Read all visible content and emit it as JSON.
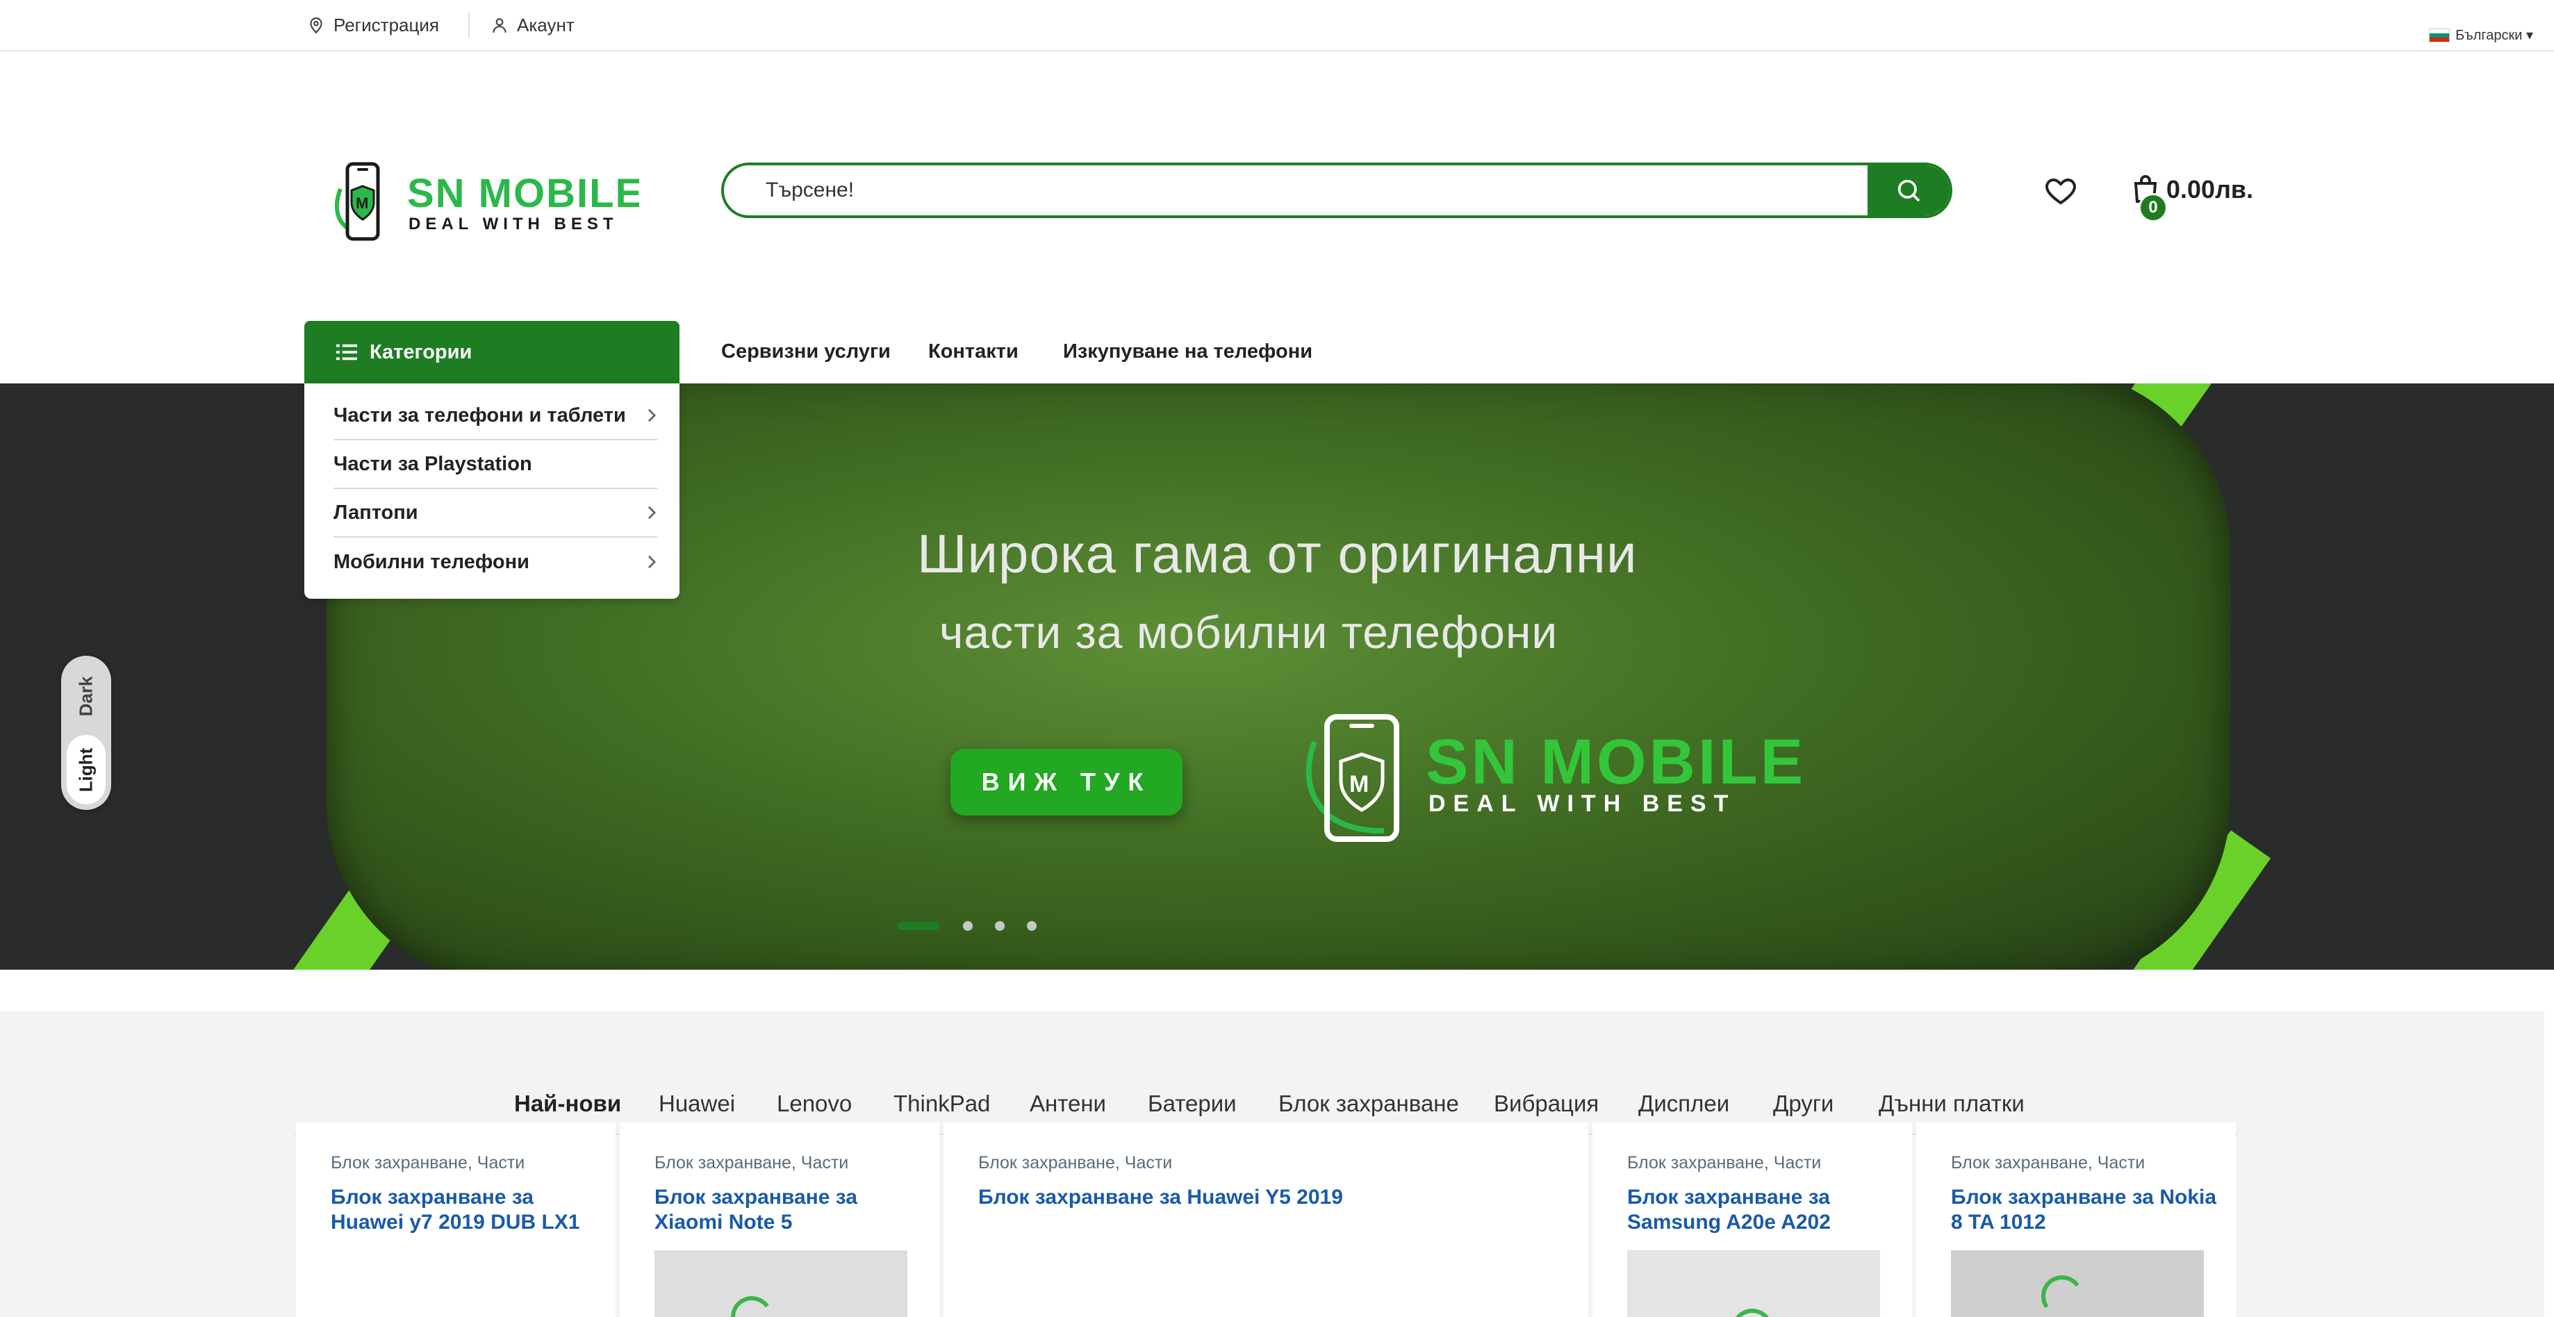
{
  "topbar": {
    "register_label": "Регистрация",
    "account_label": "Акаунт",
    "language_label": "Български ▾"
  },
  "header": {
    "search_placeholder": "Търсене!",
    "cart_count": "0",
    "cart_total": "0.00лв."
  },
  "nav": {
    "categories_label": "Категории",
    "links": [
      "Сервизни услуги",
      "Контакти",
      "Изкупуване на телефони"
    ]
  },
  "categories_menu": {
    "items": [
      {
        "label": "Части за телефони и таблети",
        "has_submenu": true
      },
      {
        "label": "Части за Playstation",
        "has_submenu": false
      },
      {
        "label": "Лаптопи",
        "has_submenu": true
      },
      {
        "label": "Мобилни телефони",
        "has_submenu": true
      }
    ]
  },
  "hero": {
    "line1": "Широка гама от оригинални",
    "line2": "части за мобилни телефони",
    "button_label": "ВИЖ ТУК",
    "slides_count": 4,
    "active_slide": 1
  },
  "theme_switcher": {
    "dark_label": "Dark",
    "light_label": "Light",
    "selected": "Light"
  },
  "products": {
    "tabs": [
      "Най-нови",
      "Huawei",
      "Lenovo",
      "ThinkPad",
      "Антени",
      "Батерии",
      "Блок захранване",
      "Вибрация",
      "Дисплеи",
      "Други",
      "Дънни платки"
    ],
    "active_tab": "Най-нови",
    "cards": [
      {
        "cat1": "Блок захранване",
        "cat2": "Части",
        "title_line1": "Блок захранване за",
        "title_line2": "Huawei y7 2019 DUB LX1"
      },
      {
        "cat1": "Блок захранване",
        "cat2": "Части",
        "title_line1": "Блок захранване за",
        "title_line2": "Xiaomi Note 5"
      },
      {
        "cat1": "Блок захранване",
        "cat2": "Части",
        "title_line1": "Блок захранване за Huawei Y5 2019",
        "title_line2": ""
      },
      {
        "cat1": "Блок захранване",
        "cat2": "Части",
        "title_line1": "Блок захранване за",
        "title_line2": "Samsung A20e A202"
      },
      {
        "cat1": "Блок захранване",
        "cat2": "Части",
        "title_line1": "Блок захранване за Nokia",
        "title_line2": "8 TA 1012"
      }
    ]
  },
  "colors": {
    "brand_green": "#1e7d22",
    "link_blue": "#1a5aa8",
    "hero_button": "#22a822"
  }
}
